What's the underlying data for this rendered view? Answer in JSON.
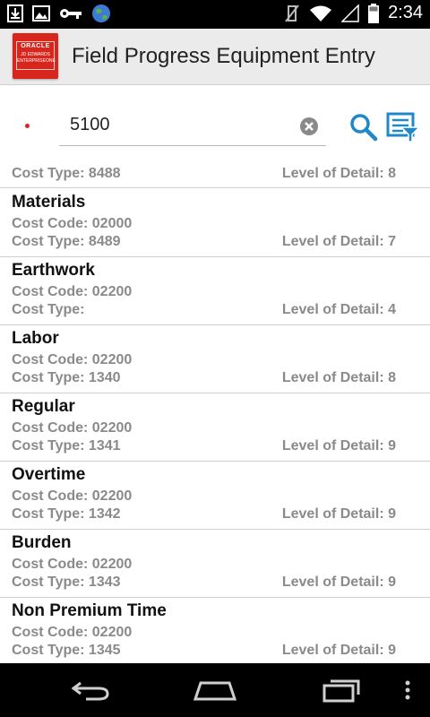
{
  "status_bar": {
    "time": "2:34"
  },
  "app": {
    "title": "Field Progress Equipment Entry",
    "logo_lines": [
      "ORACLE",
      "JD EDWARDS",
      "ENTERPRISEONE"
    ]
  },
  "search": {
    "value": "5100"
  },
  "list": {
    "partial_row": {
      "cost_type": "Cost Type: 8488",
      "level_of_detail": "Level of Detail: 8"
    },
    "items": [
      {
        "title": "Materials",
        "cost_code": "Cost Code: 02000",
        "cost_type": "Cost Type: 8489",
        "level_of_detail": "Level of Detail: 7"
      },
      {
        "title": "Earthwork",
        "cost_code": "Cost Code: 02200",
        "cost_type": "Cost Type:",
        "level_of_detail": "Level of Detail: 4"
      },
      {
        "title": "Labor",
        "cost_code": "Cost Code: 02200",
        "cost_type": "Cost Type: 1340",
        "level_of_detail": "Level of Detail: 8"
      },
      {
        "title": "Regular",
        "cost_code": "Cost Code: 02200",
        "cost_type": "Cost Type: 1341",
        "level_of_detail": "Level of Detail: 9"
      },
      {
        "title": "Overtime",
        "cost_code": "Cost Code: 02200",
        "cost_type": "Cost Type: 1342",
        "level_of_detail": "Level of Detail: 9"
      },
      {
        "title": "Burden",
        "cost_code": "Cost Code: 02200",
        "cost_type": "Cost Type: 1343",
        "level_of_detail": "Level of Detail: 9"
      },
      {
        "title": "Non Premium Time",
        "cost_code": "Cost Code: 02200",
        "cost_type": "Cost Type: 1345",
        "level_of_detail": "Level of Detail: 9"
      }
    ]
  },
  "colors": {
    "accent": "#1e88c8",
    "logo_red": "#d9261c",
    "required": "#e02020",
    "meta_text": "#8a8a8a"
  },
  "icons": {
    "status_left": [
      "download-icon",
      "image-icon",
      "key-icon",
      "globe-icon"
    ],
    "status_right": [
      "vibrate-off-icon",
      "wifi-icon",
      "signal-icon",
      "battery-icon"
    ],
    "nav": [
      "back-icon",
      "home-icon",
      "recents-icon",
      "menu-dots-icon"
    ]
  }
}
